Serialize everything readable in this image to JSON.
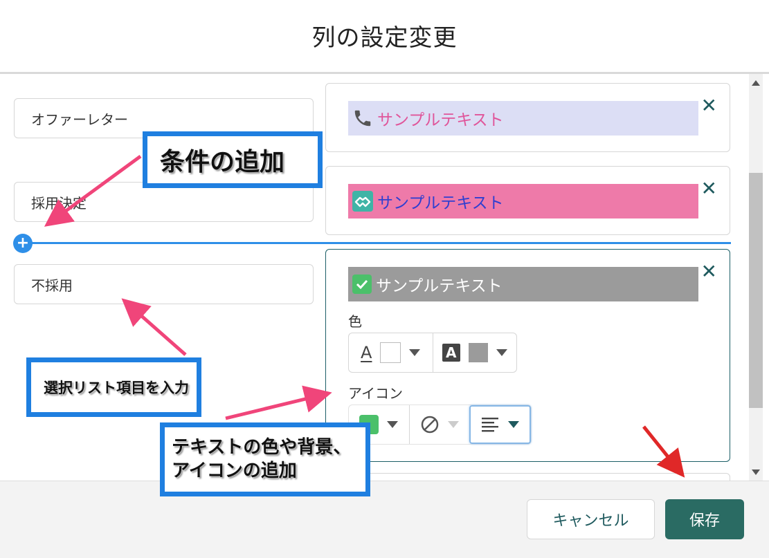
{
  "dialog": {
    "title": "列の設定変更"
  },
  "rows": [
    {
      "value": "オファーレター",
      "preview_text": "サンプルテキスト",
      "icon": "phone-icon"
    },
    {
      "value": "採用決定",
      "preview_text": "サンプルテキスト",
      "icon": "handshake-icon"
    },
    {
      "value": "不採用",
      "preview_text": "サンプルテキスト",
      "icon": "check-icon"
    }
  ],
  "editor": {
    "color_label": "色",
    "icon_label": "アイコン",
    "text_color_glyph": "A",
    "bg_color_glyph": "A"
  },
  "colors": {
    "row1_bg": "#dcdef5",
    "row1_text": "#e0559a",
    "row2_bg": "#ee7aa9",
    "row2_text": "#2f3fd0",
    "row3_bg": "#9b9b9b",
    "row3_text": "#ffffff",
    "accent": "#2e8fe8",
    "save": "#2a6b63"
  },
  "footer": {
    "cancel_label": "キャンセル",
    "save_label": "保存"
  },
  "annotations": {
    "add_condition": "条件の追加",
    "enter_picklist": "選択リスト項目を入力",
    "text_color_line1": "テキストの色や背景、",
    "text_color_line2": "アイコンの追加"
  }
}
